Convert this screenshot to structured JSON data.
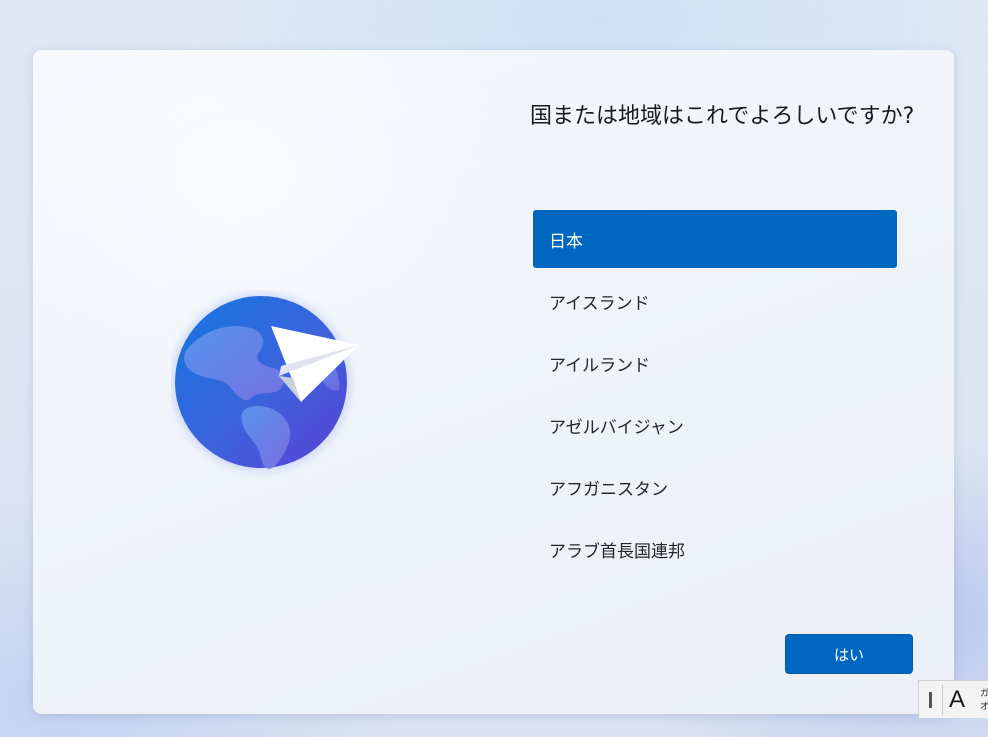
{
  "dialog": {
    "heading": "国または地域はこれでよろしいですか?",
    "countries": [
      {
        "label": "日本",
        "selected": true
      },
      {
        "label": "アイスランド",
        "selected": false
      },
      {
        "label": "アイルランド",
        "selected": false
      },
      {
        "label": "アゼルバイジャン",
        "selected": false
      },
      {
        "label": "アフガニスタン",
        "selected": false
      },
      {
        "label": "アラブ首長国連邦",
        "selected": false
      }
    ],
    "yes_button_label": "はい"
  },
  "ime": {
    "mode": "A",
    "small_lines": [
      "ガ",
      "オ"
    ]
  },
  "colors": {
    "accent": "#0067c0",
    "text": "#1b1b1b"
  },
  "icons": {
    "illustration": "globe-paper-plane-icon"
  }
}
